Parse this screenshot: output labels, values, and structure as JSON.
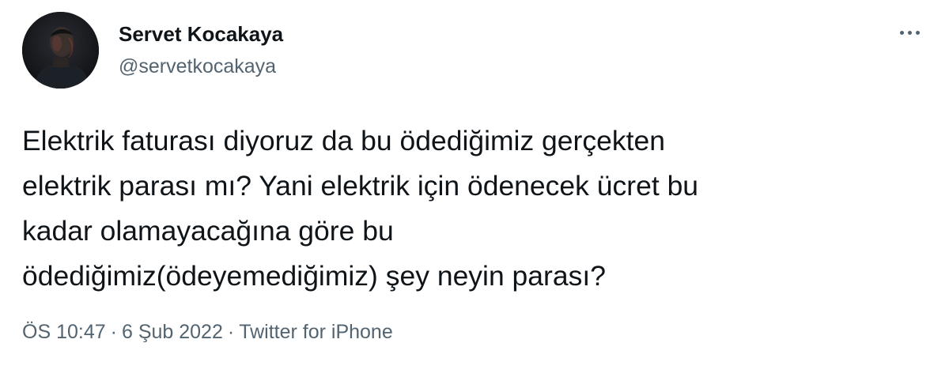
{
  "author": {
    "name": "Servet Kocakaya",
    "handle": "@servetkocakaya",
    "avatar_icon": "profile-photo"
  },
  "more_menu_icon": "more-horizontal-icon",
  "tweet": {
    "lines": [
      "Elektrik faturası diyoruz da bu ödediğimiz gerçekten",
      "elektrik parası mı? Yani elektrik için ödenecek ücret bu",
      "kadar olamayacağına göre bu",
      "ödediğimiz(ödeyemediğimiz) şey neyin parası?"
    ]
  },
  "meta": {
    "time": "ÖS 10:47",
    "separator": "·",
    "date": "6 Şub 2022",
    "source": "Twitter for iPhone"
  },
  "colors": {
    "text": "#0f1419",
    "secondary": "#536471",
    "background": "#ffffff"
  }
}
